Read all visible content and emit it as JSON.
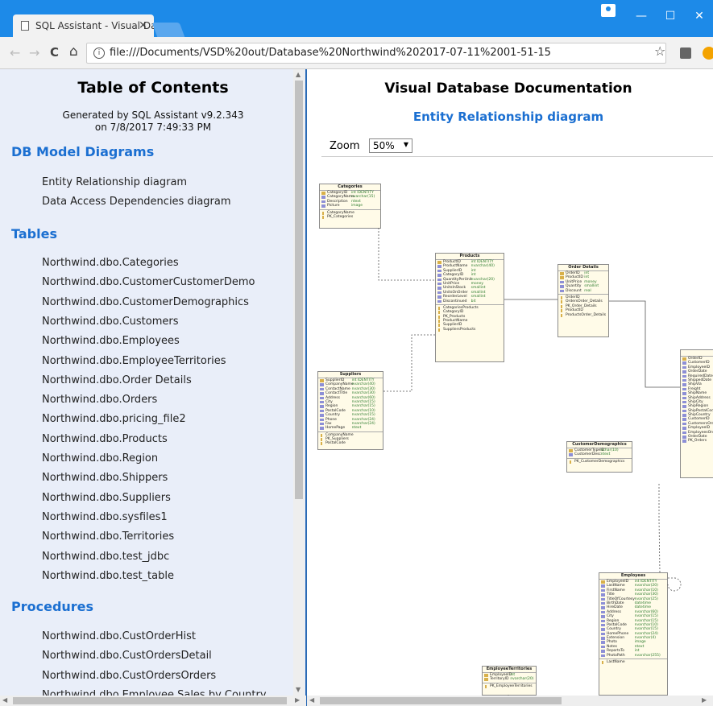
{
  "browser": {
    "tab_title": "SQL Assistant - Visual Da",
    "tab_close": "×",
    "url": "file:///Documents/VSD%20out/Database%20Northwind%202017-07-11%2001-51-15",
    "info_glyph": "i",
    "star_glyph": "☆",
    "minimize_glyph": "—",
    "maximize_glyph": "☐",
    "close_glyph": "✕",
    "back_glyph": "←",
    "forward_glyph": "→",
    "reload_glyph": "C",
    "home_glyph": "⌂"
  },
  "toc": {
    "title": "Table of Contents",
    "generated_line1": "Generated by SQL Assistant v9.2.343",
    "generated_line2": "on 7/8/2017 7:49:33 PM",
    "diagrams_heading": "DB Model Diagrams",
    "diagrams": [
      "Entity Relationship diagram",
      "Data Access Dependencies diagram"
    ],
    "tables_heading": "Tables",
    "tables": [
      "Northwind.dbo.Categories",
      "Northwind.dbo.CustomerCustomerDemo",
      "Northwind.dbo.CustomerDemographics",
      "Northwind.dbo.Customers",
      "Northwind.dbo.Employees",
      "Northwind.dbo.EmployeeTerritories",
      "Northwind.dbo.Order Details",
      "Northwind.dbo.Orders",
      "Northwind.dbo.pricing_file2",
      "Northwind.dbo.Products",
      "Northwind.dbo.Region",
      "Northwind.dbo.Shippers",
      "Northwind.dbo.Suppliers",
      "Northwind.dbo.sysfiles1",
      "Northwind.dbo.Territories",
      "Northwind.dbo.test_jdbc",
      "Northwind.dbo.test_table"
    ],
    "procedures_heading": "Procedures",
    "procedures": [
      "Northwind.dbo.CustOrderHist",
      "Northwind.dbo.CustOrdersDetail",
      "Northwind.dbo.CustOrdersOrders",
      "Northwind.dbo.Employee Sales by Country"
    ]
  },
  "doc": {
    "title": "Visual Database Documentation",
    "subtitle": "Entity Relationship diagram",
    "zoom_label": "Zoom",
    "zoom_value": "50%"
  },
  "er": {
    "categories": {
      "title": "Categories",
      "cols": [
        [
          "CategoryID",
          "int IDENTITY",
          true
        ],
        [
          "CategoryName",
          "nvarchar(15)",
          false
        ],
        [
          "Description",
          "ntext",
          false
        ],
        [
          "Picture",
          "image",
          false
        ]
      ],
      "idx": [
        "CategoryName",
        "PK_Categories"
      ]
    },
    "products": {
      "title": "Products",
      "cols": [
        [
          "ProductID",
          "int IDENTITY",
          true
        ],
        [
          "ProductName",
          "nvarchar(40)",
          false
        ],
        [
          "SupplierID",
          "int",
          false
        ],
        [
          "CategoryID",
          "int",
          false
        ],
        [
          "QuantityPerUnit",
          "nvarchar(20)",
          false
        ],
        [
          "UnitPrice",
          "money",
          false
        ],
        [
          "UnitsInStock",
          "smallint",
          false
        ],
        [
          "UnitsOnOrder",
          "smallint",
          false
        ],
        [
          "ReorderLevel",
          "smallint",
          false
        ],
        [
          "Discontinued",
          "bit",
          false
        ]
      ],
      "idx": [
        "CategoriesProducts",
        "CategoryID",
        "PK_Products",
        "ProductName",
        "SupplierID",
        "SuppliersProducts"
      ]
    },
    "order_details": {
      "title": "Order Details",
      "cols": [
        [
          "OrderID",
          "int",
          true
        ],
        [
          "ProductID",
          "int",
          true
        ],
        [
          "UnitPrice",
          "money",
          false
        ],
        [
          "Quantity",
          "smallint",
          false
        ],
        [
          "Discount",
          "real",
          false
        ]
      ],
      "idx": [
        "OrderID",
        "OrdersOrder_Details",
        "PK_Order_Details",
        "ProductID",
        "ProductsOrder_Details"
      ]
    },
    "suppliers": {
      "title": "Suppliers",
      "cols": [
        [
          "SupplierID",
          "int IDENTITY",
          true
        ],
        [
          "CompanyName",
          "nvarchar(40)",
          false
        ],
        [
          "ContactName",
          "nvarchar(30)",
          false
        ],
        [
          "ContactTitle",
          "nvarchar(30)",
          false
        ],
        [
          "Address",
          "nvarchar(60)",
          false
        ],
        [
          "City",
          "nvarchar(15)",
          false
        ],
        [
          "Region",
          "nvarchar(15)",
          false
        ],
        [
          "PostalCode",
          "nvarchar(10)",
          false
        ],
        [
          "Country",
          "nvarchar(15)",
          false
        ],
        [
          "Phone",
          "nvarchar(24)",
          false
        ],
        [
          "Fax",
          "nvarchar(24)",
          false
        ],
        [
          "HomePage",
          "ntext",
          false
        ]
      ],
      "idx": [
        "CompanyName",
        "PK_Suppliers",
        "PostalCode"
      ]
    },
    "customer_demographics": {
      "title": "CustomerDemographics",
      "cols": [
        [
          "CustomerTypeID",
          "nchar(10)",
          true
        ],
        [
          "CustomerDesc",
          "ntext",
          false
        ]
      ],
      "idx": [
        "PK_CustomerDemographics"
      ]
    },
    "orders": {
      "title": "",
      "cols": [
        [
          "OrderID",
          "",
          true
        ],
        [
          "CustomerID",
          "",
          false
        ],
        [
          "EmployeeID",
          "",
          false
        ],
        [
          "OrderDate",
          "",
          false
        ],
        [
          "RequiredDate",
          "",
          false
        ],
        [
          "ShippedDate",
          "",
          false
        ],
        [
          "ShipVia",
          "",
          false
        ],
        [
          "Freight",
          "",
          false
        ],
        [
          "ShipName",
          "",
          false
        ],
        [
          "ShipAddress",
          "",
          false
        ],
        [
          "ShipCity",
          "",
          false
        ],
        [
          "ShipRegion",
          "",
          false
        ],
        [
          "ShipPostalCode",
          "",
          false
        ],
        [
          "ShipCountry",
          "",
          false
        ],
        [
          "CustomerID",
          "",
          false
        ],
        [
          "CustomersOrders",
          "",
          false
        ],
        [
          "EmployeeID",
          "",
          false
        ],
        [
          "EmployeesOrders",
          "",
          false
        ],
        [
          "OrderDate",
          "",
          false
        ],
        [
          "PK_Orders",
          "",
          false
        ]
      ],
      "idx": []
    },
    "employees": {
      "title": "Employees",
      "cols": [
        [
          "EmployeeID",
          "int IDENTITY",
          true
        ],
        [
          "LastName",
          "nvarchar(20)",
          false
        ],
        [
          "FirstName",
          "nvarchar(10)",
          false
        ],
        [
          "Title",
          "nvarchar(30)",
          false
        ],
        [
          "TitleOfCourtesy",
          "nvarchar(25)",
          false
        ],
        [
          "BirthDate",
          "datetime",
          false
        ],
        [
          "HireDate",
          "datetime",
          false
        ],
        [
          "Address",
          "nvarchar(60)",
          false
        ],
        [
          "City",
          "nvarchar(15)",
          false
        ],
        [
          "Region",
          "nvarchar(15)",
          false
        ],
        [
          "PostalCode",
          "nvarchar(10)",
          false
        ],
        [
          "Country",
          "nvarchar(15)",
          false
        ],
        [
          "HomePhone",
          "nvarchar(24)",
          false
        ],
        [
          "Extension",
          "nvarchar(4)",
          false
        ],
        [
          "Photo",
          "image",
          false
        ],
        [
          "Notes",
          "ntext",
          false
        ],
        [
          "ReportsTo",
          "int",
          false
        ],
        [
          "PhotoPath",
          "nvarchar(255)",
          false
        ]
      ],
      "idx": [
        "LastName"
      ]
    },
    "employee_territories": {
      "title": "EmployeeTerritories",
      "cols": [
        [
          "EmployeeID",
          "int",
          true
        ],
        [
          "TerritoryID",
          "nvarchar(20)",
          true
        ]
      ],
      "idx": [
        "PK_EmployeeTerritories"
      ]
    }
  }
}
